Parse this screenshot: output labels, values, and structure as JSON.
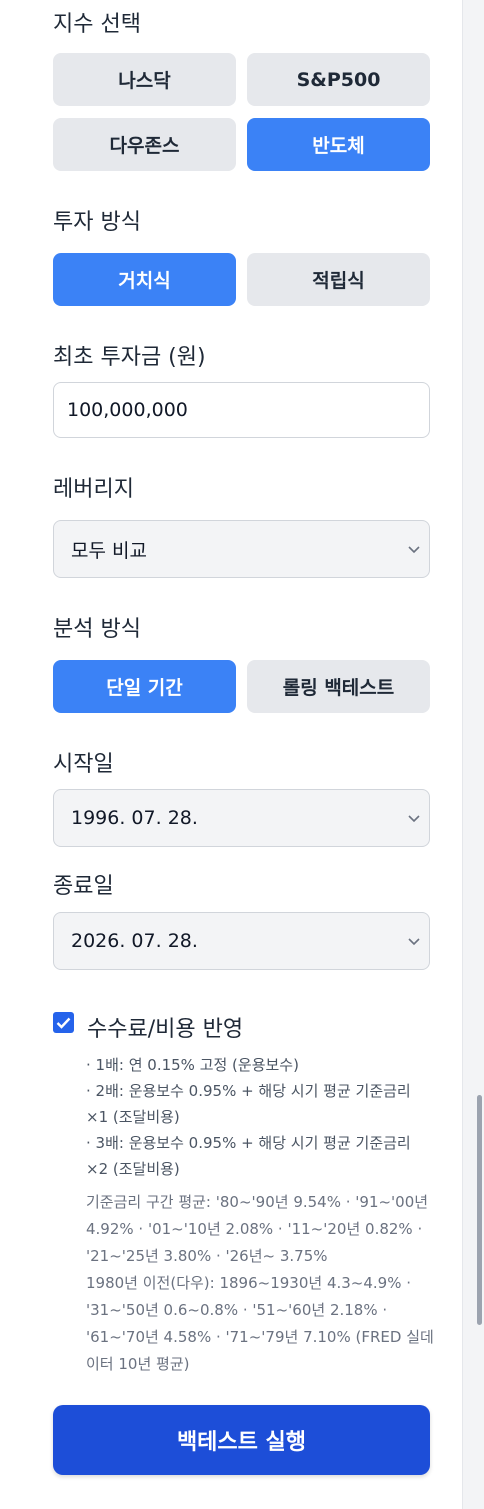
{
  "index": {
    "label": "지수 선택",
    "options": [
      "나스닥",
      "S&P500",
      "다우존스",
      "반도체"
    ],
    "selected": "반도체"
  },
  "method": {
    "label": "투자 방식",
    "options": [
      "거치식",
      "적립식"
    ],
    "selected": "거치식"
  },
  "initial": {
    "label": "최초 투자금 (원)",
    "value": "100,000,000"
  },
  "leverage": {
    "label": "레버리지",
    "value": "모두 비교"
  },
  "analysis": {
    "label": "분석 방식",
    "options": [
      "단일 기간",
      "롤링 백테스트"
    ],
    "selected": "단일 기간"
  },
  "start": {
    "label": "시작일",
    "value": "1996. 07. 28."
  },
  "end": {
    "label": "종료일",
    "value": "2026. 07. 28."
  },
  "fees": {
    "checked": true,
    "label": "수수료/비용 반영",
    "items": [
      "· 1배: 연 0.15% 고정 (운용보수)",
      "· 2배: 운용보수 0.95% + 해당 시기 평균 기준금리 ×1 (조달비용)",
      "· 3배: 운용보수 0.95% + 해당 시기 평균 기준금리 ×2 (조달비용)"
    ],
    "rates_note": "기준금리 구간 평균: '80~'90년 9.54% · '91~'00년 4.92% · '01~'10년 2.08% · '11~'20년 0.82% · '21~'25년 3.80% · '26년~ 3.75%",
    "pre1980_note": "1980년 이전(다우): 1896~1930년 4.3~4.9% · '31~'50년 0.6~0.8% · '51~'60년 2.18% · '61~'70년 4.58% · '71~'79년 7.10% (FRED 실데이터 10년 평균)"
  },
  "run_button": "백테스트 실행",
  "colors": {
    "accent": "#3b82f6",
    "run": "#1d4ed8",
    "inactive": "#e6e8ec"
  }
}
